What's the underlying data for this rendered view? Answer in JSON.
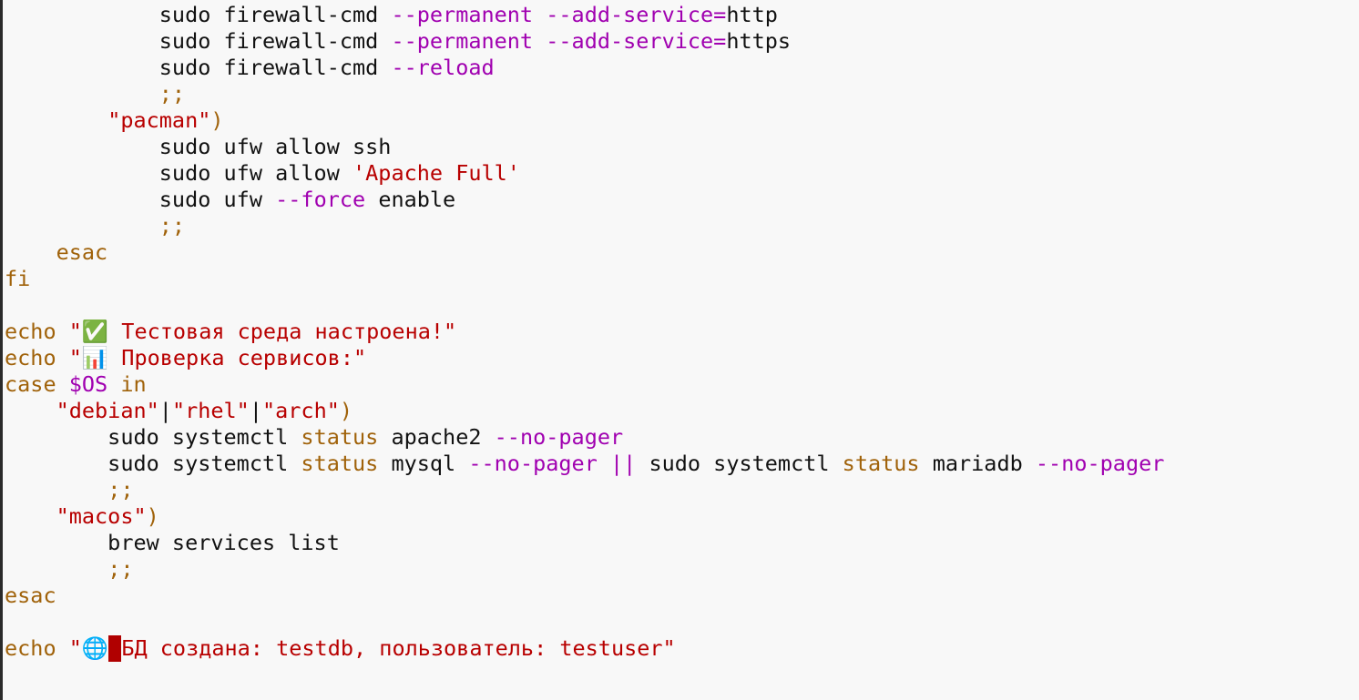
{
  "editor": {
    "cursor_glyph": " ",
    "colors": {
      "background": "#f8f8f8",
      "keyword": "#a0620a",
      "option": "#a000b0",
      "string": "#b80000",
      "text": "#111111",
      "cursor": "#b00000"
    },
    "lines": [
      [
        [
          "plain",
          "            sudo firewall-cmd "
        ],
        [
          "op",
          "--permanent"
        ],
        [
          "plain",
          " "
        ],
        [
          "op",
          "--add-service="
        ],
        [
          "plain",
          "http"
        ]
      ],
      [
        [
          "plain",
          "            sudo firewall-cmd "
        ],
        [
          "op",
          "--permanent"
        ],
        [
          "plain",
          " "
        ],
        [
          "op",
          "--add-service="
        ],
        [
          "plain",
          "https"
        ]
      ],
      [
        [
          "plain",
          "            sudo firewall-cmd "
        ],
        [
          "op",
          "--reload"
        ]
      ],
      [
        [
          "plain",
          "            "
        ],
        [
          "kw",
          ";;"
        ]
      ],
      [
        [
          "plain",
          "        "
        ],
        [
          "str",
          "\"pacman\""
        ],
        [
          "kw",
          ")"
        ]
      ],
      [
        [
          "plain",
          "            sudo ufw allow ssh"
        ]
      ],
      [
        [
          "plain",
          "            sudo ufw allow "
        ],
        [
          "str",
          "'Apache Full'"
        ]
      ],
      [
        [
          "plain",
          "            sudo ufw "
        ],
        [
          "op",
          "--force"
        ],
        [
          "plain",
          " enable"
        ]
      ],
      [
        [
          "plain",
          "            "
        ],
        [
          "kw",
          ";;"
        ]
      ],
      [
        [
          "plain",
          "    "
        ],
        [
          "kw",
          "esac"
        ]
      ],
      [
        [
          "kw",
          "fi"
        ]
      ],
      [],
      [
        [
          "kw",
          "echo"
        ],
        [
          "plain",
          " "
        ],
        [
          "str",
          "\"✅ Тестовая среда настроена!\""
        ]
      ],
      [
        [
          "kw",
          "echo"
        ],
        [
          "plain",
          " "
        ],
        [
          "str",
          "\"📊 Проверка сервисов:\""
        ]
      ],
      [
        [
          "kw",
          "case"
        ],
        [
          "plain",
          " "
        ],
        [
          "op",
          "$OS"
        ],
        [
          "plain",
          " "
        ],
        [
          "kw",
          "in"
        ]
      ],
      [
        [
          "plain",
          "    "
        ],
        [
          "str",
          "\"debian\""
        ],
        [
          "plain",
          "|"
        ],
        [
          "str",
          "\"rhel\""
        ],
        [
          "plain",
          "|"
        ],
        [
          "str",
          "\"arch\""
        ],
        [
          "kw",
          ")"
        ]
      ],
      [
        [
          "plain",
          "        sudo systemctl "
        ],
        [
          "kw",
          "status"
        ],
        [
          "plain",
          " apache2 "
        ],
        [
          "op",
          "--no-pager"
        ]
      ],
      [
        [
          "plain",
          "        sudo systemctl "
        ],
        [
          "kw",
          "status"
        ],
        [
          "plain",
          " mysql "
        ],
        [
          "op",
          "--no-pager"
        ],
        [
          "plain",
          " "
        ],
        [
          "op",
          "||"
        ],
        [
          "plain",
          " sudo systemctl "
        ],
        [
          "kw",
          "status"
        ],
        [
          "plain",
          " mariadb "
        ],
        [
          "op",
          "--no-pager"
        ]
      ],
      [
        [
          "plain",
          "        "
        ],
        [
          "kw",
          ";;"
        ]
      ],
      [
        [
          "plain",
          "    "
        ],
        [
          "str",
          "\"macos\""
        ],
        [
          "kw",
          ")"
        ]
      ],
      [
        [
          "plain",
          "        brew services list"
        ]
      ],
      [
        [
          "plain",
          "        "
        ],
        [
          "kw",
          ";;"
        ]
      ],
      [
        [
          "kw",
          "esac"
        ]
      ],
      [],
      [
        [
          "kw",
          "echo"
        ],
        [
          "plain",
          " "
        ],
        [
          "str",
          "\"🌐"
        ],
        [
          "cursor",
          " "
        ],
        [
          "str",
          "БД создана: testdb, пользователь: testuser\""
        ]
      ]
    ]
  }
}
